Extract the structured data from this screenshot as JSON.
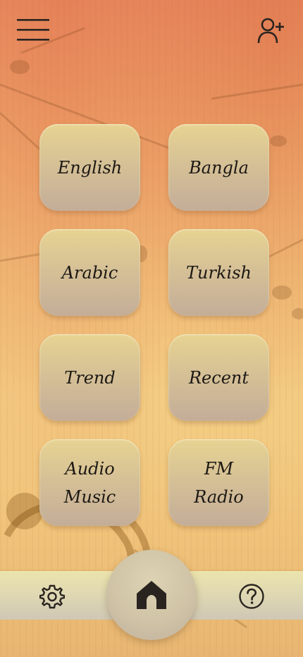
{
  "header": {
    "menu_icon": "hamburger-menu-icon",
    "add_user_icon": "add-user-icon"
  },
  "categories": [
    {
      "label": "English"
    },
    {
      "label": "Bangla"
    },
    {
      "label": "Arabic"
    },
    {
      "label": "Turkish"
    },
    {
      "label": "Trend"
    },
    {
      "label": "Recent"
    },
    {
      "label": "Audio\nMusic"
    },
    {
      "label": "FM\nRadio"
    }
  ],
  "bottom_nav": {
    "settings_icon": "gear-icon",
    "home_icon": "home-icon",
    "help_icon": "help-icon"
  },
  "colors": {
    "tile_top": "#e7d391",
    "tile_bottom": "#c3ad98",
    "text": "#1c1814",
    "nav_bar": "#e4ddb0"
  }
}
